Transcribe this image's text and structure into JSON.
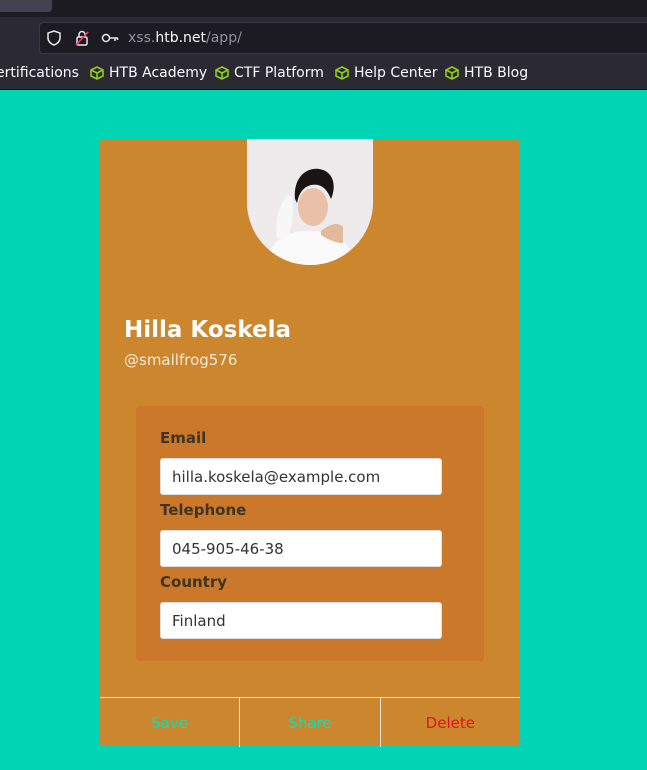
{
  "browser": {
    "url": {
      "host_prefix": "xss.",
      "host": "htb.net",
      "path": "/app/"
    },
    "bookmarks": [
      {
        "label": "ertifications"
      },
      {
        "label": "HTB Academy"
      },
      {
        "label": "CTF Platform"
      },
      {
        "label": "Help Center"
      },
      {
        "label": "HTB Blog"
      }
    ]
  },
  "profile": {
    "name": "Hilla Koskela",
    "handle": "@smallfrog576",
    "fields": {
      "email": {
        "label": "Email",
        "value": "hilla.koskela@example.com"
      },
      "telephone": {
        "label": "Telephone",
        "value": "045-905-46-38"
      },
      "country": {
        "label": "Country",
        "value": "Finland"
      }
    }
  },
  "actions": {
    "save": "Save",
    "share": "Share",
    "delete": "Delete"
  },
  "colors": {
    "page_background": "#00d4b4",
    "card": "#cc862d",
    "panel": "#cc782b",
    "action_text": "#00e2bf",
    "delete_text": "#e01515",
    "bookmark_icon": "#8ecf1d"
  }
}
